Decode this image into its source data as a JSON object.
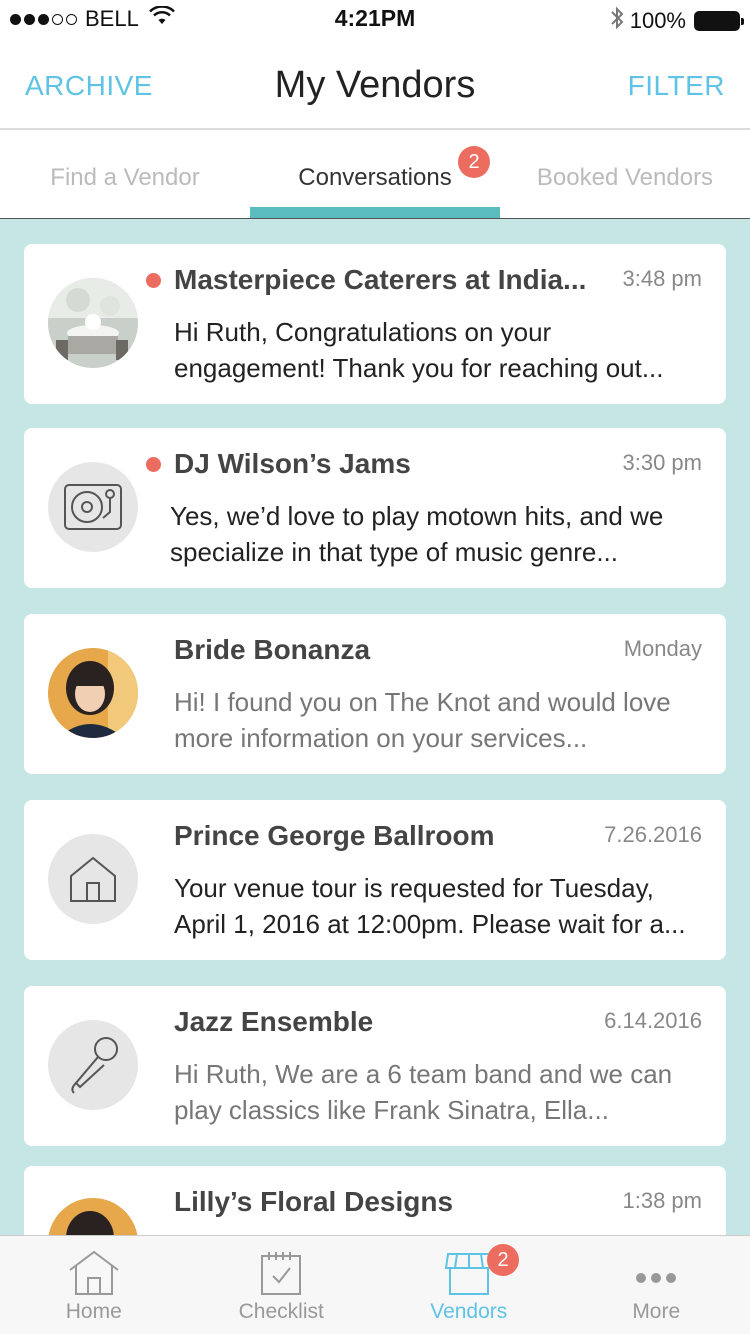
{
  "status_bar": {
    "carrier": "BELL",
    "time": "4:21PM",
    "battery": "100%"
  },
  "nav": {
    "left": "ARCHIVE",
    "title": "My Vendors",
    "right": "FILTER"
  },
  "tabs": [
    {
      "label": "Find a Vendor"
    },
    {
      "label": "Conversations",
      "badge": "2"
    },
    {
      "label": "Booked Vendors"
    }
  ],
  "conversations": [
    {
      "name": "Masterpiece Caterers at India...",
      "time": "3:48 pm",
      "message": "Hi Ruth, Congratulations on your engagement! Thank you for reaching out...",
      "unread": true,
      "avatar": "photo-venue-icon"
    },
    {
      "name": "DJ Wilson’s Jams",
      "time": "3:30 pm",
      "message": "Yes, we’d love to play motown hits, and we specialize in that type of music genre...",
      "unread": true,
      "avatar": "turntable-icon"
    },
    {
      "name": "Bride Bonanza",
      "time": "Monday",
      "message": "Hi! I found you on The Knot and would love more information on your services...",
      "unread": false,
      "avatar": "photo-person-icon"
    },
    {
      "name": "Prince George Ballroom",
      "time": "7.26.2016",
      "message": "Your venue tour is requested for Tuesday, April 1, 2016 at 12:00pm. Please wait for a...",
      "unread": false,
      "avatar": "house-icon"
    },
    {
      "name": "Jazz Ensemble",
      "time": "6.14.2016",
      "message": "Hi Ruth, We are a 6 team band and we can play classics like Frank Sinatra, Ella...",
      "unread": false,
      "avatar": "microphone-icon"
    },
    {
      "name": "Lilly’s Floral Designs",
      "time": "1:38 pm",
      "message": "",
      "unread": false,
      "avatar": "photo-person-icon"
    }
  ],
  "tab_bar": [
    {
      "label": "Home",
      "icon": "home-icon"
    },
    {
      "label": "Checklist",
      "icon": "checklist-icon"
    },
    {
      "label": "Vendors",
      "icon": "storefront-icon",
      "badge": "2"
    },
    {
      "label": "More",
      "icon": "more-icon"
    }
  ],
  "colors": {
    "accent": "#5ec3e4",
    "teal": "#5bbcbf",
    "list_bg": "#c6e6e5",
    "badge": "#ec6c5f"
  }
}
